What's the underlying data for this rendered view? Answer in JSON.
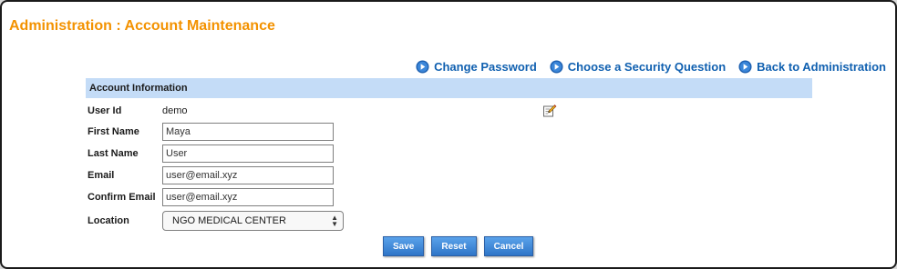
{
  "page": {
    "title": "Administration : Account Maintenance"
  },
  "links": {
    "change_password": "Change Password",
    "security_question": "Choose a Security Question",
    "back_to_admin": "Back to Administration"
  },
  "section": {
    "title": "Account Information"
  },
  "form": {
    "user_id_label": "User Id",
    "user_id_value": "demo",
    "first_name_label": "First Name",
    "first_name_value": "Maya",
    "last_name_label": "Last Name",
    "last_name_value": "User",
    "email_label": "Email",
    "email_value": "user@email.xyz",
    "confirm_email_label": "Confirm Email",
    "confirm_email_value": "user@email.xyz",
    "location_label": "Location",
    "location_value": "NGO MEDICAL CENTER"
  },
  "buttons": {
    "save": "Save",
    "reset": "Reset",
    "cancel": "Cancel"
  },
  "colors": {
    "title": "#f39200",
    "link": "#1060b0",
    "section_header_bg": "#c4dcf7",
    "button_bg": "#3a82d4"
  },
  "icons": {
    "link_bullet": "blue-arrow-circle-icon",
    "edit": "edit-pencil-icon"
  }
}
